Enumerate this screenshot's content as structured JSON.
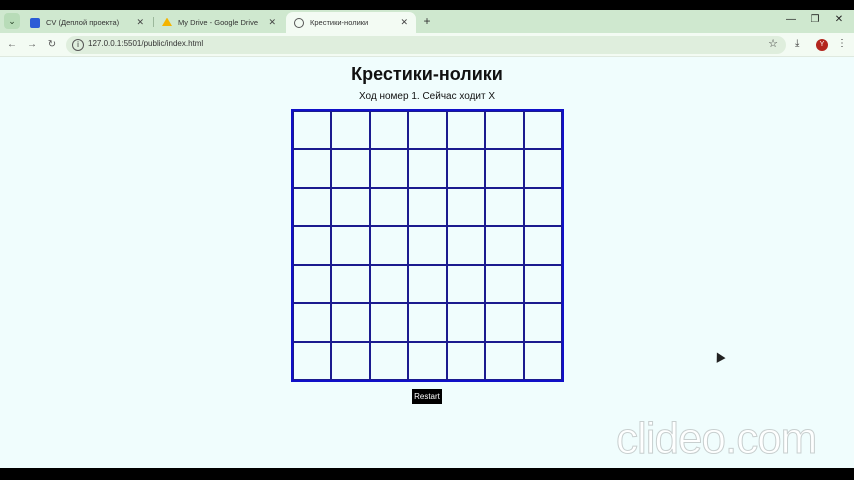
{
  "browser": {
    "tabs": [
      {
        "title": "CV (Деплой проекта)",
        "favicon_color": "#2b5cd6",
        "active": false
      },
      {
        "title": "My Drive - Google Drive",
        "favicon_color": "#f4b400",
        "active": false
      },
      {
        "title": "Крестики-нолики",
        "favicon_color": "#555555",
        "active": true
      }
    ],
    "close_glyph": "✕",
    "new_tab_glyph": "+",
    "url": "127.0.0.1:5501/public/index.html",
    "avatar_letter": "Y",
    "window_controls": {
      "minimize": "—",
      "restore": "❐",
      "close": "✕"
    }
  },
  "page": {
    "title": "Крестики-нолики",
    "status": "Ход номер 1. Сейчас ходит X",
    "restart_label": "Restart",
    "board": {
      "rows": 7,
      "cols": 7
    }
  },
  "watermark": "clideo.com",
  "colors": {
    "board_border": "#1010c8",
    "page_bg": "#f0fdfd",
    "tabstrip_bg": "#cfe8cf"
  }
}
